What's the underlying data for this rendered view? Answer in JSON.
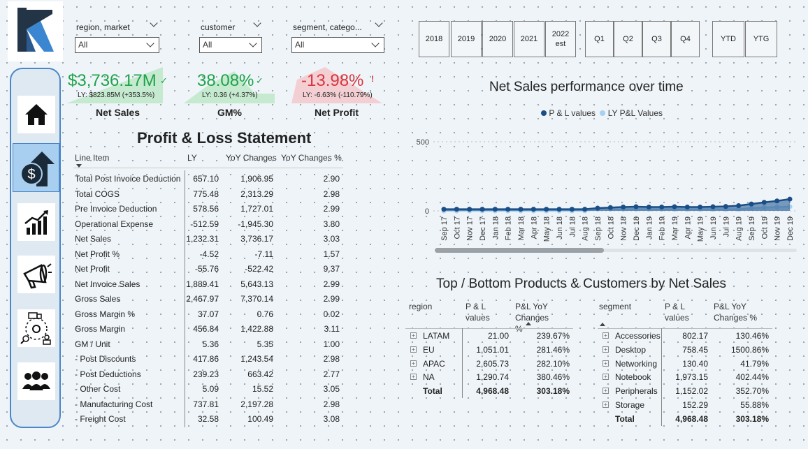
{
  "slicers": [
    {
      "title": "region, market",
      "value": "All"
    },
    {
      "title": "customer",
      "value": "All"
    },
    {
      "title": "segment, catego...",
      "value": "All"
    }
  ],
  "years": [
    "2018",
    "2019",
    "2020",
    "2021",
    "2022 est"
  ],
  "quarters": [
    "Q1",
    "Q2",
    "Q3",
    "Q4"
  ],
  "periods": [
    "YTD",
    "YTG"
  ],
  "kpis": [
    {
      "value": "$3,736.17M",
      "sub": "LY: $823.85M (+353.5%)",
      "label": "Net Sales",
      "color": "#1fa34a"
    },
    {
      "value": "38.08%",
      "sub": "LY: 0.36 (+4.37%)",
      "label": "GM%",
      "color": "#1fa34a"
    },
    {
      "value": "-13.98%",
      "sub": "LY: -6.63% (-110.79%)",
      "label": "Net Profit",
      "color": "#d9363e"
    }
  ],
  "pl": {
    "title": "Profit & Loss Statement",
    "headers": [
      "Line Item",
      "LY",
      "YoY Changes",
      "YoY Changes %"
    ],
    "rows": [
      [
        "Total Post Invoice Deduction",
        "657.10",
        "1,906.95",
        "2.90"
      ],
      [
        "Total COGS",
        "775.48",
        "2,313.29",
        "2.98"
      ],
      [
        "Pre Invoice Deduction",
        "578.56",
        "1,727.01",
        "2.99"
      ],
      [
        "Operational Expense",
        "-512.59",
        "-1,945.30",
        "3.80"
      ],
      [
        "Net Sales",
        "1,232.31",
        "3,736.17",
        "3.03"
      ],
      [
        "Net Profit %",
        "-4.52",
        "-7.11",
        "1.57"
      ],
      [
        "Net Profit",
        "-55.76",
        "-522.42",
        "9.37"
      ],
      [
        "Net Invoice Sales",
        "1,889.41",
        "5,643.13",
        "2.99"
      ],
      [
        "Gross Sales",
        "2,467.97",
        "7,370.14",
        "2.99"
      ],
      [
        "Gross Margin %",
        "37.07",
        "0.76",
        "0.02"
      ],
      [
        "Gross Margin",
        "456.84",
        "1,422.88",
        "3.11"
      ],
      [
        "GM / Unit",
        "5.36",
        "5.35",
        "1.00"
      ],
      [
        "- Post Discounts",
        "417.86",
        "1,243.54",
        "2.98"
      ],
      [
        "- Post Deductions",
        "239.23",
        "663.42",
        "2.77"
      ],
      [
        "- Other Cost",
        "5.09",
        "15.52",
        "3.05"
      ],
      [
        "- Manufacturing Cost",
        "737.81",
        "2,197.28",
        "2.98"
      ],
      [
        "- Freight Cost",
        "32.58",
        "100.49",
        "3.08"
      ]
    ]
  },
  "chart_title": "Net Sales performance over time",
  "legend": [
    "P & L values",
    "LY P&L Values"
  ],
  "chart_data": {
    "type": "area",
    "title": "Net Sales performance over time",
    "categories": [
      "Sep 17",
      "Oct 17",
      "Nov 17",
      "Dec 17",
      "Jan 18",
      "Feb 18",
      "Mar 18",
      "Apr 18",
      "May 18",
      "Jun 18",
      "Jul 18",
      "Aug 18",
      "Sep 18",
      "Oct 18",
      "Nov 18",
      "Dec 18",
      "Jan 19",
      "Feb 19",
      "Mar 19",
      "Apr 19",
      "May 19",
      "Jun 19",
      "Jul 19",
      "Aug 19",
      "Sep 19",
      "Oct 19",
      "Nov 19",
      "Dec 19"
    ],
    "series": [
      {
        "name": "P & L values",
        "color": "#1a4e86",
        "values": [
          12,
          12,
          12,
          12,
          12,
          12,
          12,
          12,
          12,
          12,
          12,
          12,
          20,
          24,
          28,
          30,
          28,
          28,
          30,
          28,
          28,
          30,
          32,
          38,
          50,
          62,
          72,
          85
        ]
      },
      {
        "name": "LY P&L Values",
        "color": "#a8d1f0",
        "values": [
          0,
          0,
          0,
          0,
          0,
          0,
          0,
          0,
          0,
          0,
          0,
          0,
          12,
          12,
          12,
          12,
          12,
          12,
          12,
          12,
          12,
          12,
          12,
          12,
          20,
          24,
          28,
          30
        ]
      }
    ],
    "y_ticks": [
      "500",
      "0"
    ],
    "ylim": [
      0,
      550
    ]
  },
  "tb_title": "Top / Bottom Products & Customers by Net Sales",
  "region_table": {
    "headers": [
      "region",
      "P & L values",
      "P&L YoY Changes %"
    ],
    "rows": [
      [
        "LATAM",
        "21.00",
        "239.67%"
      ],
      [
        "EU",
        "1,051.01",
        "281.46%"
      ],
      [
        "APAC",
        "2,605.73",
        "282.10%"
      ],
      [
        "NA",
        "1,290.74",
        "380.46%"
      ]
    ],
    "total": [
      "Total",
      "4,968.48",
      "303.18%"
    ]
  },
  "segment_table": {
    "headers": [
      "segment",
      "P & L values",
      "P&L YoY Changes %"
    ],
    "rows": [
      [
        "Accessories",
        "802.17",
        "130.46%"
      ],
      [
        "Desktop",
        "758.45",
        "1500.86%"
      ],
      [
        "Networking",
        "130.40",
        "41.79%"
      ],
      [
        "Notebook",
        "1,973.15",
        "402.44%"
      ],
      [
        "Peripherals",
        "1,152.02",
        "352.70%"
      ],
      [
        "Storage",
        "152.29",
        "55.88%"
      ]
    ],
    "total": [
      "Total",
      "4,968.48",
      "303.18%"
    ]
  }
}
